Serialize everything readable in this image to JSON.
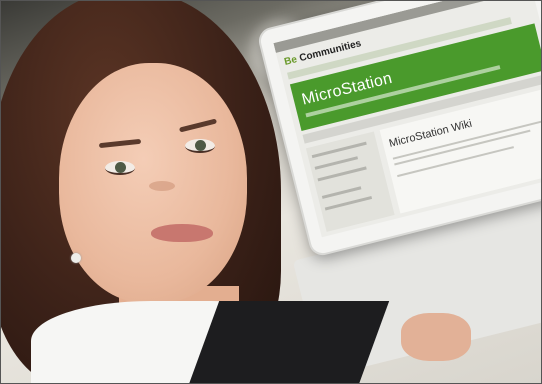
{
  "scene": {
    "site_brand_prefix": "Be",
    "site_brand": "Communities",
    "banner_title": "MicroStation",
    "page_heading": "MicroStation Wiki"
  }
}
